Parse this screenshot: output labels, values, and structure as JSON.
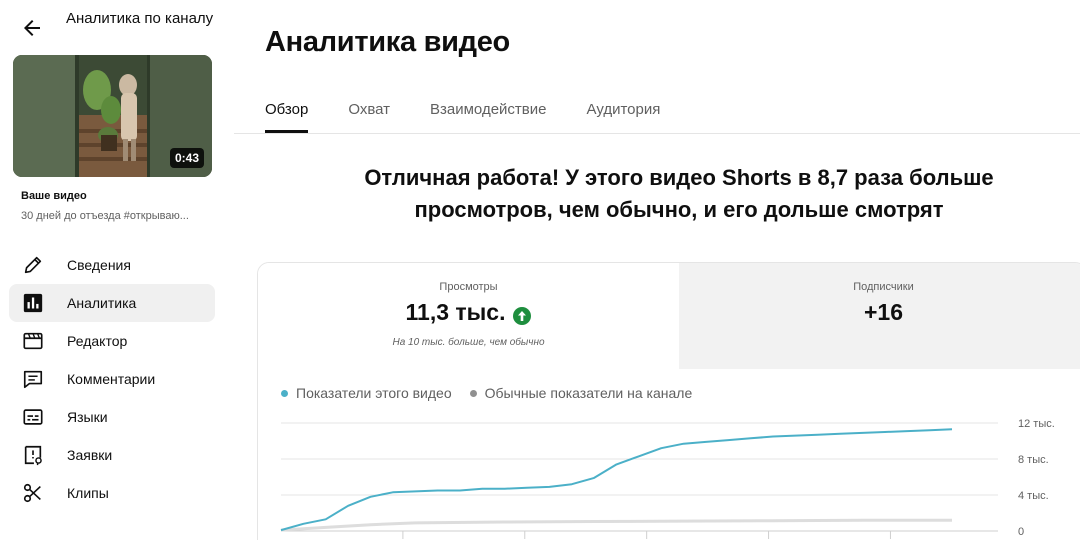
{
  "sidebar": {
    "title": "Аналитика по каналу",
    "thumbnail": {
      "duration": "0:43"
    },
    "your_video_label": "Ваше видео",
    "video_description": "30 дней до отъезда #открываю...",
    "items": [
      {
        "label": "Сведения",
        "icon": "pencil-icon"
      },
      {
        "label": "Аналитика",
        "icon": "analytics-icon",
        "active": true
      },
      {
        "label": "Редактор",
        "icon": "editor-icon"
      },
      {
        "label": "Комментарии",
        "icon": "comments-icon"
      },
      {
        "label": "Языки",
        "icon": "subtitles-icon"
      },
      {
        "label": "Заявки",
        "icon": "claims-icon"
      },
      {
        "label": "Клипы",
        "icon": "scissors-icon"
      }
    ]
  },
  "main": {
    "title": "Аналитика видео",
    "tabs": [
      {
        "label": "Обзор",
        "active": true
      },
      {
        "label": "Охват"
      },
      {
        "label": "Взаимодействие"
      },
      {
        "label": "Аудитория"
      }
    ],
    "headline": "Отличная работа! У этого видео Shorts в 8,7 раза больше просмотров, чем обычно, и его дольше смотрят",
    "metrics": [
      {
        "label": "Просмотры",
        "value": "11,3 тыс.",
        "sub": "На 10 тыс. больше, чем обычно",
        "trend_icon": "arrow-up-circle-icon"
      },
      {
        "label": "Подписчики",
        "value": "+16"
      }
    ],
    "legend": [
      {
        "label": "Показатели этого видео",
        "color": "#4bb0c8"
      },
      {
        "label": "Обычные показатели на канале",
        "color": "#909090"
      }
    ]
  },
  "colors": {
    "accent": "#4bb0c8",
    "up_green": "#1e8e3e"
  },
  "chart_data": {
    "type": "line",
    "ylim": [
      0,
      12
    ],
    "ytick_labels": [
      "12 тыс.",
      "8 тыс.",
      "4 тыс.",
      "0"
    ],
    "yticks": [
      12,
      8,
      4,
      0
    ],
    "series": [
      {
        "name": "Показатели этого видео",
        "x": [
          0,
          1,
          2,
          3,
          4,
          5,
          6,
          7,
          8,
          9,
          10,
          11,
          12,
          13,
          14,
          15,
          16,
          17,
          18,
          19,
          20,
          21,
          22,
          23,
          24,
          25,
          26,
          27,
          28,
          29,
          30
        ],
        "values": [
          0.1,
          0.8,
          1.3,
          2.8,
          3.8,
          4.3,
          4.4,
          4.5,
          4.5,
          4.7,
          4.7,
          4.8,
          4.9,
          5.2,
          5.9,
          7.4,
          8.3,
          9.2,
          9.7,
          9.9,
          10.1,
          10.3,
          10.5,
          10.6,
          10.7,
          10.8,
          10.9,
          11.0,
          11.1,
          11.2,
          11.3
        ]
      },
      {
        "name": "Обычные показатели на канале",
        "x": [
          0,
          2,
          4,
          6,
          10,
          14,
          18,
          22,
          26,
          30
        ],
        "values": [
          0.1,
          0.4,
          0.7,
          0.9,
          1.0,
          1.05,
          1.1,
          1.15,
          1.2,
          1.2
        ]
      }
    ]
  }
}
